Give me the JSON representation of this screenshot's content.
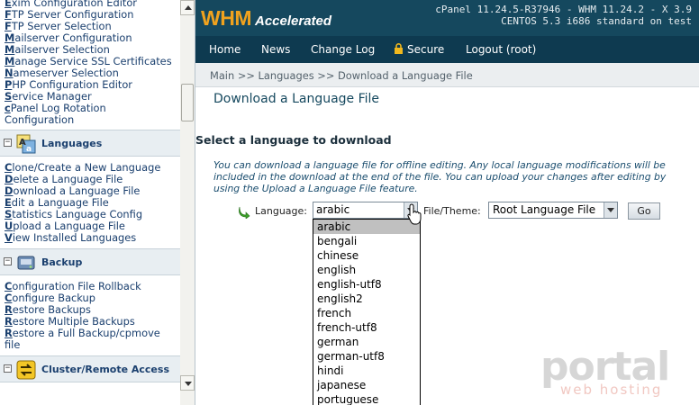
{
  "sidebar": {
    "top_items": [
      {
        "lead": "E",
        "rest": "xim Configuration Editor"
      },
      {
        "lead": "F",
        "rest": "TP Server Configuration"
      },
      {
        "lead": "F",
        "rest": "TP Server Selection"
      },
      {
        "lead": "M",
        "rest": "ailserver Configuration"
      },
      {
        "lead": "M",
        "rest": "ailserver Selection"
      },
      {
        "lead": "M",
        "rest": "anage Service SSL Certificates"
      },
      {
        "lead": "N",
        "rest": "ameserver Selection"
      },
      {
        "lead": "P",
        "rest": "HP Configuration Editor"
      },
      {
        "lead": "S",
        "rest": "ervice Manager"
      },
      {
        "lead": "c",
        "rest": "Panel Log Rotation"
      },
      {
        "lead": "",
        "rest": "Configuration"
      }
    ],
    "sections": [
      {
        "title": "Languages",
        "items": [
          {
            "lead": "C",
            "rest": "lone/Create a New Language"
          },
          {
            "lead": "D",
            "rest": "elete a Language File"
          },
          {
            "lead": "D",
            "rest": "ownload a Language File"
          },
          {
            "lead": "E",
            "rest": "dit a Language File"
          },
          {
            "lead": "S",
            "rest": "tatistics Language Config"
          },
          {
            "lead": "U",
            "rest": "pload a Language File"
          },
          {
            "lead": "V",
            "rest": "iew Installed Languages"
          }
        ]
      },
      {
        "title": "Backup",
        "items": [
          {
            "lead": "C",
            "rest": "onfiguration File Rollback"
          },
          {
            "lead": "C",
            "rest": "onfigure Backup"
          },
          {
            "lead": "R",
            "rest": "estore Backups"
          },
          {
            "lead": "R",
            "rest": "estore Multiple Backups"
          },
          {
            "lead": "R",
            "rest": "estore a Full Backup/cpmove"
          },
          {
            "lead": "",
            "rest": "file"
          }
        ]
      },
      {
        "title": "Cluster/Remote Access",
        "items": []
      }
    ]
  },
  "header": {
    "logo_main": "WHM",
    "logo_sub": "Accelerated",
    "version_line1": "cPanel 11.24.5-R37946 - WHM 11.24.2 - X 3.9",
    "version_line2": "CENTOS 5.3 i686 standard on test"
  },
  "nav": {
    "home": "Home",
    "news": "News",
    "changelog": "Change Log",
    "secure": "Secure",
    "logout": "Logout (root)"
  },
  "breadcrumb": "Main >> Languages >> Download a Language File",
  "content": {
    "title": "Download a Language File",
    "section_heading": "Select a language to download",
    "description": "You can download a language file for offline editing. Any local language modifications will be included in the download at the end of the file. You can upload your changes after editing by using the Upload a Language File feature.",
    "language_label": "Language:",
    "language_value": "arabic",
    "file_theme_label": "File/Theme:",
    "file_theme_value": "Root Language File",
    "go_label": "Go",
    "language_options": [
      "arabic",
      "bengali",
      "chinese",
      "english",
      "english-utf8",
      "english2",
      "french",
      "french-utf8",
      "german",
      "german-utf8",
      "hindi",
      "japanese",
      "portuguese"
    ]
  },
  "watermark": {
    "brand": "portal",
    "tagline": "web hosting"
  },
  "colors": {
    "header_bg": "#15485e",
    "nav_bg": "#0e3a50",
    "logo_accent": "#f0a21e",
    "link": "#1a3f6e"
  }
}
